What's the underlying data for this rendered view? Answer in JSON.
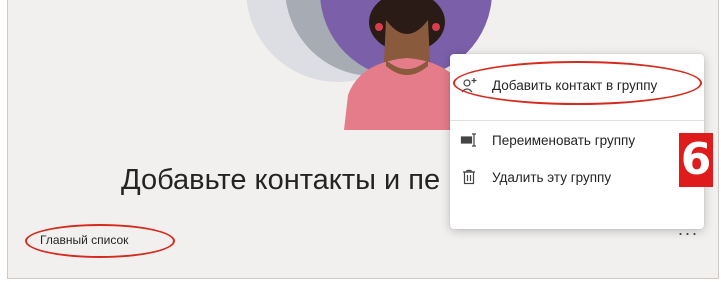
{
  "empty_state": {
    "title": "Добавьте контакты и пе"
  },
  "group": {
    "name": "Главный список",
    "more_label": "···"
  },
  "context_menu": {
    "items": [
      {
        "label": "Добавить контакт в группу",
        "icon": "add-person-icon"
      },
      {
        "label": "Переименовать группу",
        "icon": "rename-icon"
      },
      {
        "label": "Удалить эту группу",
        "icon": "trash-icon"
      }
    ]
  },
  "annotation": {
    "step_number": "6",
    "highlight_color": "#d52b1e"
  },
  "colors": {
    "background": "#f2f0ef",
    "avatar_purple": "#7b5fa9",
    "circle_gray": "#a7abb3"
  }
}
